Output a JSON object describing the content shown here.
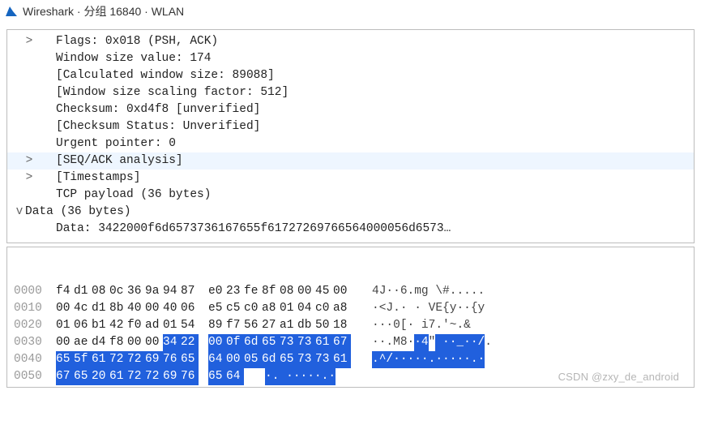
{
  "title": "Wireshark · 分组 16840 · WLAN",
  "tree": {
    "rows": [
      {
        "caret": ">",
        "indent": 2,
        "text": "Flags: 0x018 (PSH, ACK)",
        "interact": true
      },
      {
        "caret": "",
        "indent": 2,
        "text": "Window size value: 174",
        "interact": false
      },
      {
        "caret": "",
        "indent": 2,
        "text": "[Calculated window size: 89088]",
        "interact": false
      },
      {
        "caret": "",
        "indent": 2,
        "text": "[Window size scaling factor: 512]",
        "interact": false
      },
      {
        "caret": "",
        "indent": 2,
        "text": "Checksum: 0xd4f8 [unverified]",
        "interact": false
      },
      {
        "caret": "",
        "indent": 2,
        "text": "[Checksum Status: Unverified]",
        "interact": false
      },
      {
        "caret": "",
        "indent": 2,
        "text": "Urgent pointer: 0",
        "interact": false
      },
      {
        "caret": ">",
        "indent": 2,
        "text": "[SEQ/ACK analysis]",
        "interact": true,
        "hilite": true
      },
      {
        "caret": ">",
        "indent": 2,
        "text": "[Timestamps]",
        "interact": true
      },
      {
        "caret": "",
        "indent": 2,
        "text": "TCP payload (36 bytes)",
        "interact": false
      },
      {
        "caret": "v",
        "indent": 0,
        "text": "Data (36 bytes)",
        "interact": true
      },
      {
        "caret": "",
        "indent": 2,
        "text": "Data: 3422000f6d6573736167655f61727269766564000056d6573…",
        "interact": true
      }
    ]
  },
  "hex": {
    "rows": [
      {
        "offset": "0000",
        "bytes": [
          "f4",
          "d1",
          "08",
          "0c",
          "36",
          "9a",
          "94",
          "87",
          "e0",
          "23",
          "fe",
          "8f",
          "08",
          "00",
          "45",
          "00"
        ],
        "sel": [
          0,
          0,
          0,
          0,
          0,
          0,
          0,
          0,
          0,
          0,
          0,
          0,
          0,
          0,
          0,
          0
        ],
        "ascii": "4J··6.mg \\#....."
      },
      {
        "offset": "0010",
        "bytes": [
          "00",
          "4c",
          "d1",
          "8b",
          "40",
          "00",
          "40",
          "06",
          "e5",
          "c5",
          "c0",
          "a8",
          "01",
          "04",
          "c0",
          "a8"
        ],
        "sel": [
          0,
          0,
          0,
          0,
          0,
          0,
          0,
          0,
          0,
          0,
          0,
          0,
          0,
          0,
          0,
          0
        ],
        "ascii": "·<J.· · VE{y··{y"
      },
      {
        "offset": "0020",
        "bytes": [
          "01",
          "06",
          "b1",
          "42",
          "f0",
          "ad",
          "01",
          "54",
          "89",
          "f7",
          "56",
          "27",
          "a1",
          "db",
          "50",
          "18"
        ],
        "sel": [
          0,
          0,
          0,
          0,
          0,
          0,
          0,
          0,
          0,
          0,
          0,
          0,
          0,
          0,
          0,
          0
        ],
        "ascii": "···0[· i7.'~.&"
      },
      {
        "offset": "0030",
        "bytes": [
          "00",
          "ae",
          "d4",
          "f8",
          "00",
          "00",
          "34",
          "22",
          "00",
          "0f",
          "6d",
          "65",
          "73",
          "73",
          "61",
          "67"
        ],
        "sel": [
          0,
          0,
          0,
          0,
          0,
          0,
          1,
          1,
          1,
          1,
          1,
          1,
          1,
          1,
          1,
          1
        ],
        "ascii": "··.M8··4\" ··_··/.",
        "ascsel": [
          0,
          0,
          0,
          0,
          0,
          0,
          1,
          1,
          0,
          1,
          1,
          1,
          1,
          1,
          1,
          1
        ]
      },
      {
        "offset": "0040",
        "bytes": [
          "65",
          "5f",
          "61",
          "72",
          "72",
          "69",
          "76",
          "65",
          "64",
          "00",
          "05",
          "6d",
          "65",
          "73",
          "73",
          "61"
        ],
        "sel": [
          1,
          1,
          1,
          1,
          1,
          1,
          1,
          1,
          1,
          1,
          1,
          1,
          1,
          1,
          1,
          1
        ],
        "ascii": ".^/·····.·····.·",
        "ascsel": [
          1,
          1,
          1,
          1,
          1,
          1,
          1,
          1,
          1,
          1,
          1,
          1,
          1,
          1,
          1,
          1
        ]
      },
      {
        "offset": "0050",
        "bytes": [
          "67",
          "65",
          "20",
          "61",
          "72",
          "72",
          "69",
          "76",
          "65",
          "64"
        ],
        "sel": [
          1,
          1,
          1,
          1,
          1,
          1,
          1,
          1,
          1,
          1
        ],
        "ascii": "·. ·····.·",
        "ascsel": [
          1,
          1,
          1,
          1,
          1,
          1,
          1,
          1,
          1,
          1
        ]
      }
    ]
  },
  "watermark": "CSDN @zxy_de_android"
}
